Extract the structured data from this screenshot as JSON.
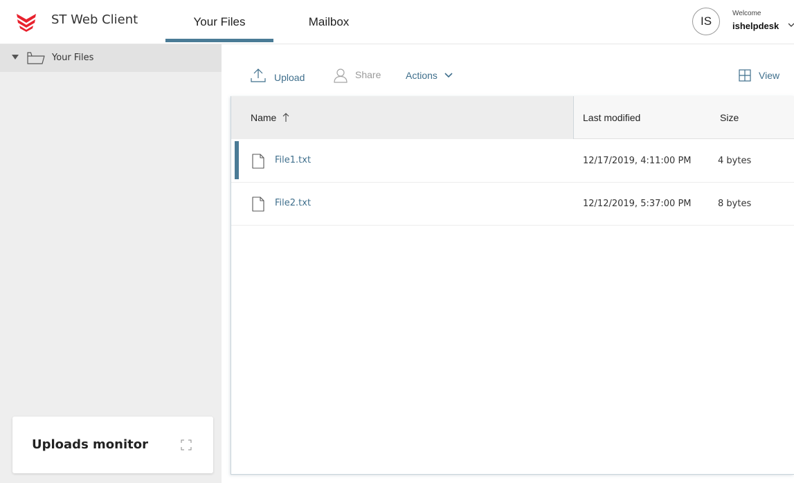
{
  "header": {
    "app_title": "ST Web Client",
    "brand_color": "#e8222e",
    "accent_color": "#4a7b96",
    "tabs": [
      {
        "label": "Your Files",
        "active": true
      },
      {
        "label": "Mailbox",
        "active": false
      }
    ],
    "user": {
      "initials": "IS",
      "welcome": "Welcome",
      "username": "ishelpdesk"
    }
  },
  "sidebar": {
    "tree": [
      {
        "label": "Your Files",
        "icon": "folder-icon",
        "expanded": true
      }
    ],
    "uploads_monitor": {
      "title": "Uploads monitor",
      "icon": "expand-icon"
    }
  },
  "toolbar": {
    "upload_label": "Upload",
    "share_label": "Share",
    "actions_label": "Actions",
    "view_label": "View"
  },
  "table": {
    "columns": {
      "name": "Name",
      "modified": "Last modified",
      "size": "Size"
    },
    "sort": {
      "column": "name",
      "direction": "ascending"
    },
    "rows": [
      {
        "name": "File1.txt",
        "modified": "12/17/2019, 4:11:00 PM",
        "size": "4 bytes",
        "selected": true
      },
      {
        "name": "File2.txt",
        "modified": "12/12/2019, 5:37:00 PM",
        "size": "8 bytes",
        "selected": false
      }
    ]
  }
}
